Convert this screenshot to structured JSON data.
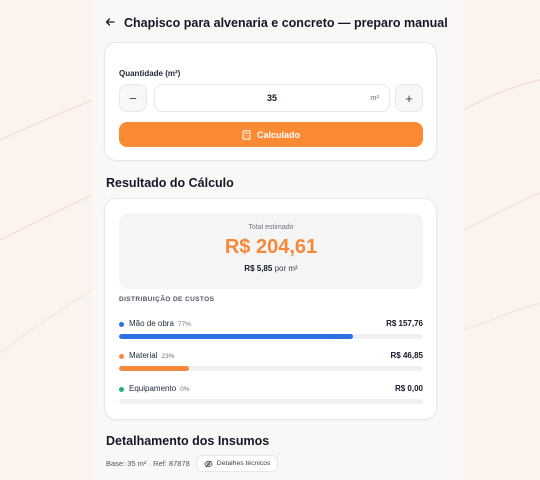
{
  "header": {
    "back_icon": "arrow-left-icon",
    "title": "Chapisco para alvenaria e concreto — preparo manual"
  },
  "quantity": {
    "label": "Quantidade (m²)",
    "value": "35",
    "unit": "m²",
    "minus_symbol": "−",
    "plus_symbol": "+"
  },
  "calculate_button": {
    "label": "Calculado",
    "icon": "calculator-icon"
  },
  "result": {
    "section_title": "Resultado do Cálculo",
    "total_label": "Total estimado",
    "total_value": "R$ 204,61",
    "per_unit_value": "R$ 5,85",
    "per_unit_suffix": "por m²",
    "distribution_label": "DISTRIBUIÇÃO DE CUSTOS",
    "items": [
      {
        "name": "Mão de obra",
        "percent_label": "77%",
        "amount": "R$ 157,76",
        "fraction": 0.77,
        "color": "#2f6fe4"
      },
      {
        "name": "Material",
        "percent_label": "23%",
        "amount": "R$ 46,85",
        "fraction": 0.23,
        "color": "#f5883a"
      },
      {
        "name": "Equipamento",
        "percent_label": "0%",
        "amount": "R$ 0,00",
        "fraction": 0.0,
        "color": "#22b07d"
      }
    ]
  },
  "details": {
    "section_title": "Detalhamento dos Insumos",
    "base_text": "Base: 35 m² · Ref: 87878",
    "tech_button_label": "Detalhes técnicos",
    "tech_button_icon": "eye-off-icon"
  },
  "colors": {
    "accent": "#fb8a34",
    "total": "#f5883a"
  }
}
